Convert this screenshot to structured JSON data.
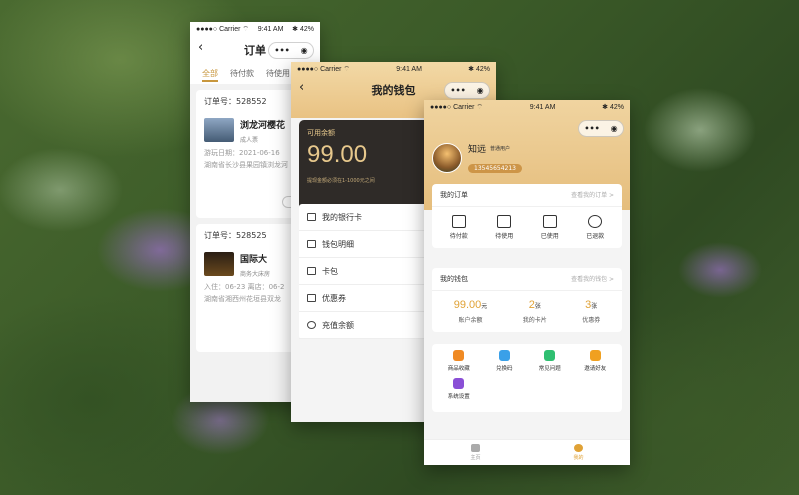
{
  "status": {
    "carrier": "●●●●○ Carrier ⌔",
    "time": "9:41 AM",
    "battery": "✱ 42%"
  },
  "orders_screen": {
    "title": "订单",
    "tabs": [
      "全部",
      "待付款",
      "待使用"
    ],
    "orders": [
      {
        "no": "订单号：528552",
        "name": "浏龙河樱花",
        "sub": "成人票",
        "date": "游玩日期：2021-06-16",
        "addr": "湖南省长沙县果园镇浏龙河"
      },
      {
        "no": "订单号：528525",
        "name": "国际大",
        "sub": "商务大床房",
        "date": "入住：06-23  离店：06-2",
        "addr": "湖南省湘西州花垣县双龙"
      }
    ]
  },
  "wallet_screen": {
    "title": "我的钱包",
    "card_label": "可用余额",
    "balance": "99.00",
    "card_tip": "提现金额必须在1-1000元之间",
    "menu": [
      "我的银行卡",
      "钱包明细",
      "卡包",
      "优惠券",
      "充值余额"
    ]
  },
  "profile_screen": {
    "user_name": "知远",
    "user_level": "普通用户",
    "phone": "13545654213",
    "orders_title": "我的订单",
    "orders_more": "查看我的订单 >",
    "order_icons": [
      {
        "label": "待付款",
        "icon": "wallet-icon"
      },
      {
        "label": "待使用",
        "icon": "ticket-icon"
      },
      {
        "label": "已使用",
        "icon": "check-icon"
      },
      {
        "label": "已退款",
        "icon": "yen-icon"
      }
    ],
    "wallet_title": "我的钱包",
    "wallet_more": "查看我的钱包 >",
    "wallet_stats": [
      {
        "value": "99.00",
        "unit": "元",
        "label": "账户余额"
      },
      {
        "value": "2",
        "unit": "张",
        "label": "我的卡片"
      },
      {
        "value": "3",
        "unit": "张",
        "label": "优惠券"
      }
    ],
    "tools": [
      {
        "label": "商品收藏",
        "color": "#f08a24"
      },
      {
        "label": "兑换码",
        "color": "#3aa0e8"
      },
      {
        "label": "常见问题",
        "color": "#2fbf71"
      },
      {
        "label": "邀请好友",
        "color": "#f0a020"
      },
      {
        "label": "系统设置",
        "color": "#8a4fd6"
      }
    ],
    "tabbar": [
      "主页",
      "我的"
    ]
  }
}
